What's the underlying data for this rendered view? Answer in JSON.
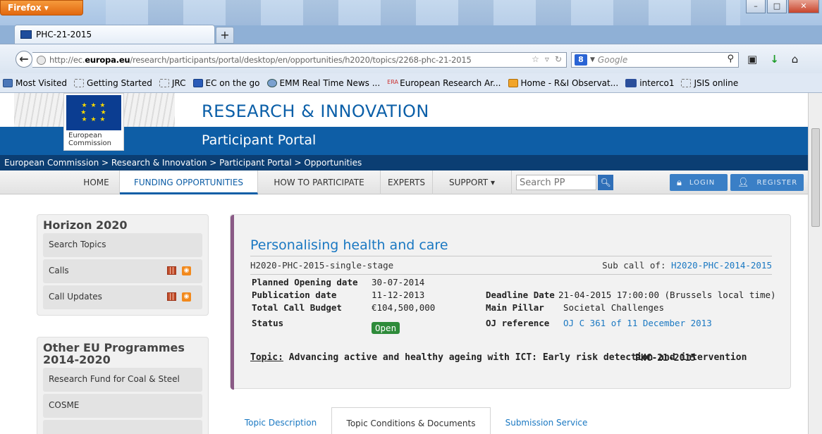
{
  "browser": {
    "menu_button": "Firefox ▾",
    "tab_title": "PHC-21-2015",
    "new_tab": "+",
    "url_prefix": "http://ec.",
    "url_host": "europa.eu",
    "url_rest": "/research/participants/portal/desktop/en/opportunities/h2020/topics/2268-phc-21-2015",
    "search_engine": "Google",
    "search_engine_badge": "8",
    "window_controls": {
      "minimize": "–",
      "maximize": "□",
      "close": "✕"
    }
  },
  "bookmarks": [
    {
      "label": "Most Visited",
      "icon": "most-visited-icon"
    },
    {
      "label": "Getting Started",
      "icon": "page-icon"
    },
    {
      "label": "JRC",
      "icon": "page-icon"
    },
    {
      "label": "EC on the go",
      "icon": "eu-flag-icon"
    },
    {
      "label": "EMM Real Time News ...",
      "icon": "globe-icon"
    },
    {
      "label": "European Research Ar...",
      "icon": "era-icon"
    },
    {
      "label": "Home - R&I Observat...",
      "icon": "observatory-icon"
    },
    {
      "label": "interco1",
      "icon": "cdc-icon"
    },
    {
      "label": "JSIS online",
      "icon": "page-icon"
    }
  ],
  "site": {
    "logo_line1": "European",
    "logo_line2": "Commission",
    "title": "RESEARCH & INNOVATION",
    "subtitle": "Participant Portal",
    "breadcrumb": "European Commission > Research & Innovation > Participant Portal > Opportunities"
  },
  "menu": {
    "home": "HOME",
    "funding": "FUNDING OPPORTUNITIES",
    "how": "HOW TO PARTICIPATE",
    "experts": "EXPERTS",
    "support": "SUPPORT ▾",
    "search_placeholder": "Search PP",
    "login": "LOGIN",
    "register": "REGISTER"
  },
  "sidebar": {
    "h2020_title": "Horizon 2020",
    "h2020_items": [
      "Search Topics",
      "Calls",
      "Call Updates"
    ],
    "other_title_1": "Other EU Programmes",
    "other_title_2": "2014-2020",
    "other_items": [
      "Research Fund for Coal & Steel",
      "COSME"
    ]
  },
  "topic": {
    "title": "Personalising health and care",
    "identifier": "H2020-PHC-2015-single-stage",
    "subcall_label": "Sub call of: ",
    "subcall_value": "H2020-PHC-2014-2015",
    "planned_opening_label": "Planned Opening date",
    "planned_opening_value": "30-07-2014",
    "publication_label": "Publication date",
    "publication_value": "11-12-2013",
    "budget_label": "Total Call Budget",
    "budget_value": "€104,500,000",
    "status_label": "Status",
    "status_value": "Open",
    "deadline_label": "Deadline Date",
    "deadline_value": "21-04-2015 17:00:00 (Brussels local time)",
    "pillar_label": "Main Pillar",
    "pillar_value": "Societal Challenges",
    "oj_label": "OJ reference",
    "oj_value": "OJ C 361 of 11 December 2013",
    "topic_label": "Topic:",
    "topic_text": " Advancing active and healthy ageing with ICT: Early risk detection and intervention",
    "topic_code": "PHC-21-2015"
  },
  "page_tabs": [
    "Topic Description",
    "Topic Conditions & Documents",
    "Submission Service"
  ],
  "colors": {
    "brand_blue": "#0e5ea6",
    "accent_purple": "#8a5a86",
    "status_green": "#2e8b3a"
  }
}
